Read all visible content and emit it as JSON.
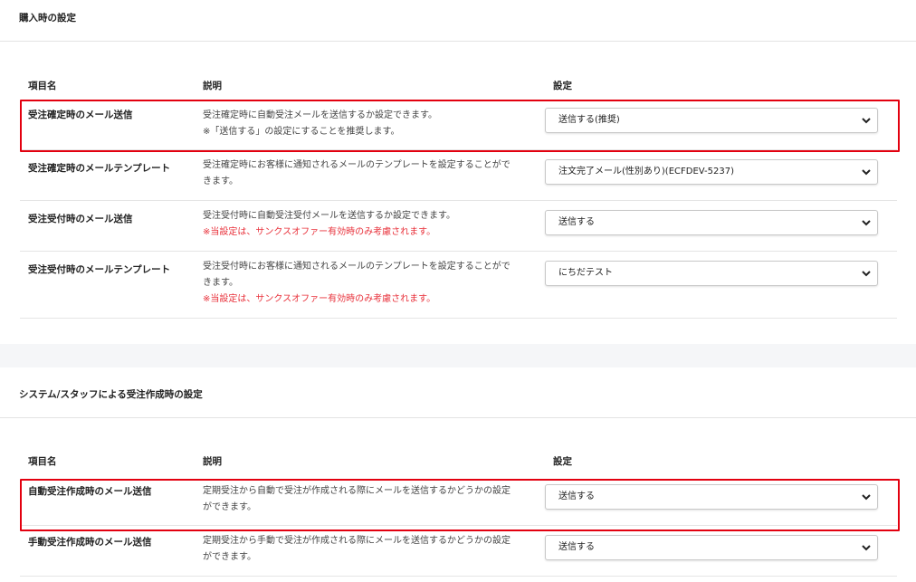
{
  "section1": {
    "title": "購入時の設定",
    "headers": {
      "name": "項目名",
      "desc": "説明",
      "setting": "設定"
    },
    "rows": [
      {
        "name": "受注確定時のメール送信",
        "desc1": "受注確定時に自動受注メールを送信するか設定できます。",
        "desc2": "※「送信する」の設定にすることを推奨します。",
        "note": "",
        "value": "送信する(推奨)"
      },
      {
        "name": "受注確定時のメールテンプレート",
        "desc1": "受注確定時にお客様に通知されるメールのテンプレートを設定することがで",
        "desc2": "きます。",
        "note": "",
        "value": "注文完了メール(性別あり)(ECFDEV-5237)"
      },
      {
        "name": "受注受付時のメール送信",
        "desc1": "受注受付時に自動受注受付メールを送信するか設定できます。",
        "desc2": "",
        "note": "※当設定は、サンクスオファー有効時のみ考慮されます。",
        "value": "送信する"
      },
      {
        "name": "受注受付時のメールテンプレート",
        "desc1": "受注受付時にお客様に通知されるメールのテンプレートを設定することがで",
        "desc2": "きます。",
        "note": "※当設定は、サンクスオファー有効時のみ考慮されます。",
        "value": "にちだテスト"
      }
    ]
  },
  "section2": {
    "title": "システム/スタッフによる受注作成時の設定",
    "headers": {
      "name": "項目名",
      "desc": "説明",
      "setting": "設定"
    },
    "rows": [
      {
        "name": "自動受注作成時のメール送信",
        "desc1": "定期受注から自動で受注が作成される際にメールを送信するかどうかの設定",
        "desc2": "ができます。",
        "value": "送信する"
      },
      {
        "name": "手動受注作成時のメール送信",
        "desc1": "定期受注から手動で受注が作成される際にメールを送信するかどうかの設定",
        "desc2": "ができます。",
        "value": "送信する"
      }
    ]
  },
  "icons": {
    "select_arrow": "chevron-down-icon"
  },
  "colors": {
    "highlight": "#e3000f",
    "note": "#e8303a"
  }
}
